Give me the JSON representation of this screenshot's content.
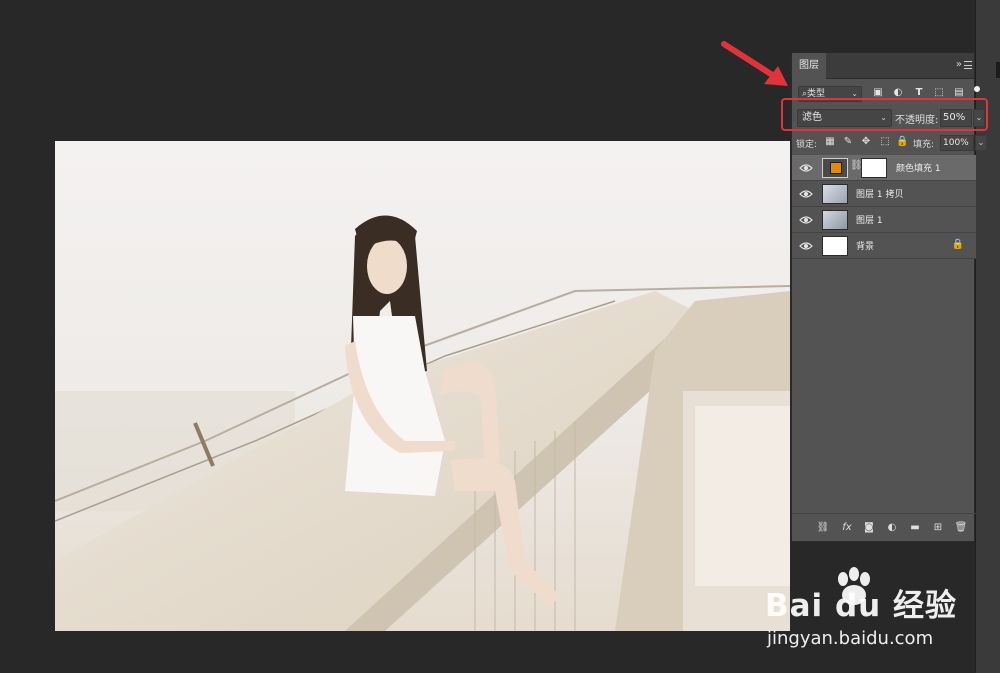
{
  "panel": {
    "tab_label": "图层",
    "collapse_glyph": "»",
    "filter": {
      "label": "类型",
      "icons": [
        "image-filter-icon",
        "adjustment-filter-icon",
        "type-filter-icon",
        "shape-filter-icon",
        "smart-object-filter-icon"
      ]
    },
    "blend_mode": "滤色",
    "opacity_label": "不透明度:",
    "opacity_value": "50%",
    "lock_label": "锁定:",
    "fill_label": "填充:",
    "fill_value": "100%",
    "layers": [
      {
        "name": "颜色填充 1",
        "visible": true,
        "selected": true,
        "thumb_color": "#e38a0c",
        "has_mask": true
      },
      {
        "name": "图层 1 拷贝",
        "visible": true,
        "selected": false
      },
      {
        "name": "图层 1",
        "visible": true,
        "selected": false
      },
      {
        "name": "背景",
        "visible": true,
        "selected": false,
        "locked": true
      }
    ],
    "footer_icons": [
      "link-layers-icon",
      "fx-icon",
      "add-mask-icon",
      "adjustment-layer-icon",
      "group-folder-icon",
      "new-layer-icon",
      "trash-icon"
    ],
    "fx_label": "fx"
  },
  "annotation": {
    "highlight_color": "#e0333a"
  },
  "watermark": {
    "brand": "Bai du 经验",
    "url": "jingyan.baidu.com"
  }
}
